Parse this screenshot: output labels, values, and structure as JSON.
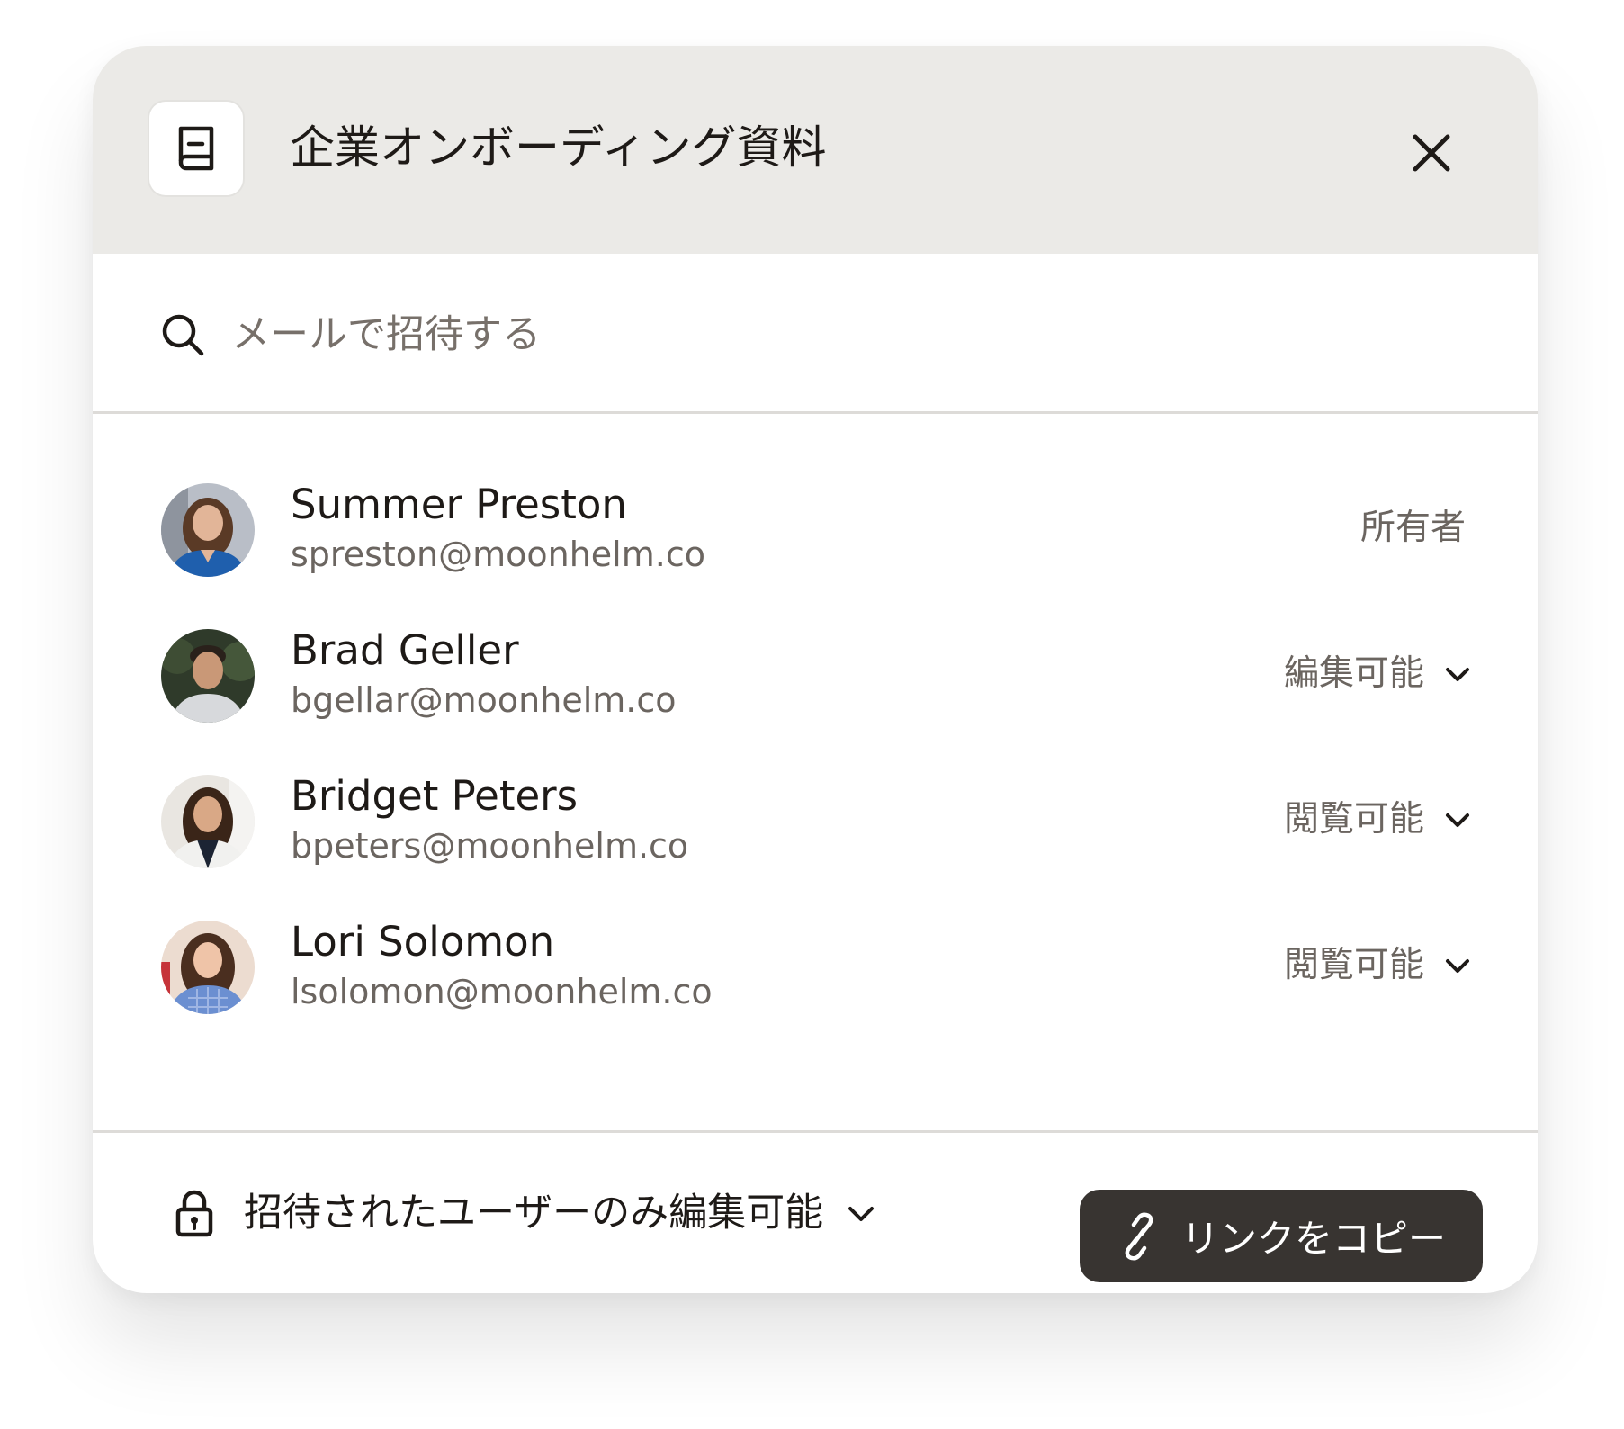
{
  "dialog": {
    "title": "企業オンボーディング資料",
    "header_icon": "book-icon",
    "close_icon": "close-icon"
  },
  "search": {
    "placeholder": "メールで招待する",
    "icon": "search-icon"
  },
  "members": [
    {
      "name": "Summer Preston",
      "email": "spreston@moonhelm.co",
      "role": "所有者",
      "has_dropdown": false
    },
    {
      "name": "Brad Geller",
      "email": "bgellar@moonhelm.co",
      "role": "編集可能",
      "has_dropdown": true
    },
    {
      "name": "Bridget Peters",
      "email": "bpeters@moonhelm.co",
      "role": "閲覧可能",
      "has_dropdown": true
    },
    {
      "name": "Lori Solomon",
      "email": "lsolomon@moonhelm.co",
      "role": "閲覧可能",
      "has_dropdown": true
    }
  ],
  "footer": {
    "access_label": "招待されたユーザーのみ編集可能",
    "access_icon": "lock-icon",
    "copy_link_label": "リンクをコピー",
    "copy_link_icon": "link-icon"
  },
  "colors": {
    "header_bg": "#ebeae7",
    "text_primary": "#1e1a17",
    "text_secondary": "#6b6560",
    "divider": "#dddbd8",
    "button_bg": "#383431",
    "button_text": "#ffffff"
  }
}
